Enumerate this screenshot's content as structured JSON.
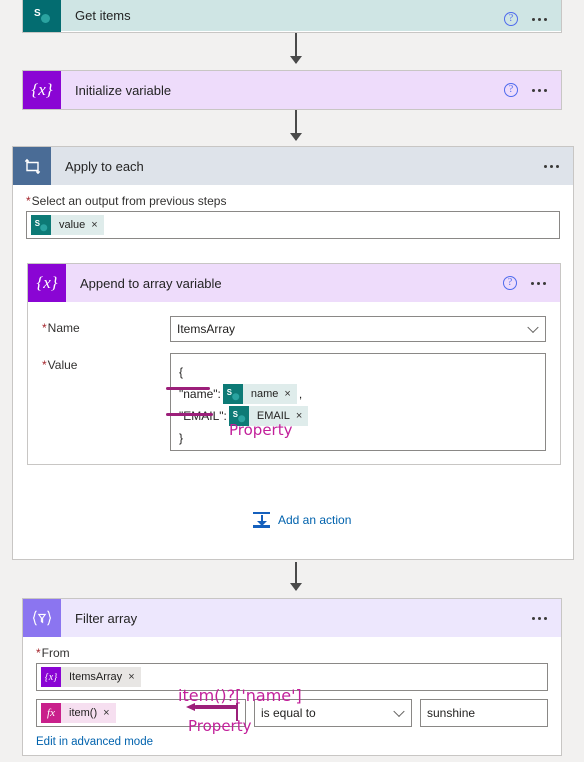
{
  "flow": {
    "steps": [
      {
        "id": "get-items",
        "title": "Get items",
        "icon": "sharepoint-icon",
        "help": "?",
        "menu": "..."
      },
      {
        "id": "initialize-variable",
        "title": "Initialize variable",
        "icon": "variable-braces-icon",
        "help": "?",
        "menu": "..."
      },
      {
        "id": "apply-to-each",
        "title": "Apply to each",
        "icon": "loop-icon",
        "menu": "...",
        "field_label": "Select an output from previous steps",
        "required_marker": "*",
        "token": {
          "label": "value",
          "icon": "sharepoint-icon",
          "remove": "×"
        },
        "add_action": {
          "label": "Add an action",
          "icon": "add-action-icon"
        },
        "inner": {
          "id": "append-to-array-variable",
          "title": "Append to array variable",
          "icon": "variable-braces-icon",
          "help": "?",
          "menu": "...",
          "name_label": "Name",
          "name_value": "ItemsArray",
          "value_label": "Value",
          "value_lines": {
            "open_brace": "{",
            "key_name": "\"name\":",
            "token_name": {
              "label": "name",
              "icon": "sharepoint-icon",
              "remove": "×"
            },
            "comma": ",",
            "key_email": "\"EMAIL\":",
            "token_email": {
              "label": "EMAIL",
              "icon": "sharepoint-icon",
              "remove": "×"
            },
            "close_brace": "}"
          }
        }
      },
      {
        "id": "filter-array",
        "title": "Filter array",
        "icon": "filter-braces-icon",
        "menu": "...",
        "from_label": "From",
        "from_token": {
          "label": "ItemsArray",
          "icon": "variable-braces-icon",
          "remove": "×"
        },
        "condition": {
          "left_token": {
            "label": "item()",
            "icon": "fx-icon",
            "remove": "×"
          },
          "operator": "is equal to",
          "right_value": "sunshine"
        },
        "advanced_link": "Edit in advanced mode"
      }
    ]
  },
  "annotations": [
    {
      "id": "property-label-append",
      "text": "Property"
    },
    {
      "id": "property-expression-filter",
      "text": "item()?['name']"
    },
    {
      "id": "property-label-filter",
      "text": "Property"
    }
  ],
  "colors": {
    "sharepoint_teal": "#036c70",
    "variable_purple": "#8a05d4",
    "loop_slate": "#4a6c96",
    "filter_violet": "#8b75f0",
    "fx_magenta": "#c9208b",
    "annotation_pink": "#c2209a",
    "link_blue": "#0062ad",
    "required_red": "#a4262c",
    "page_background": "#f2f1f0"
  }
}
